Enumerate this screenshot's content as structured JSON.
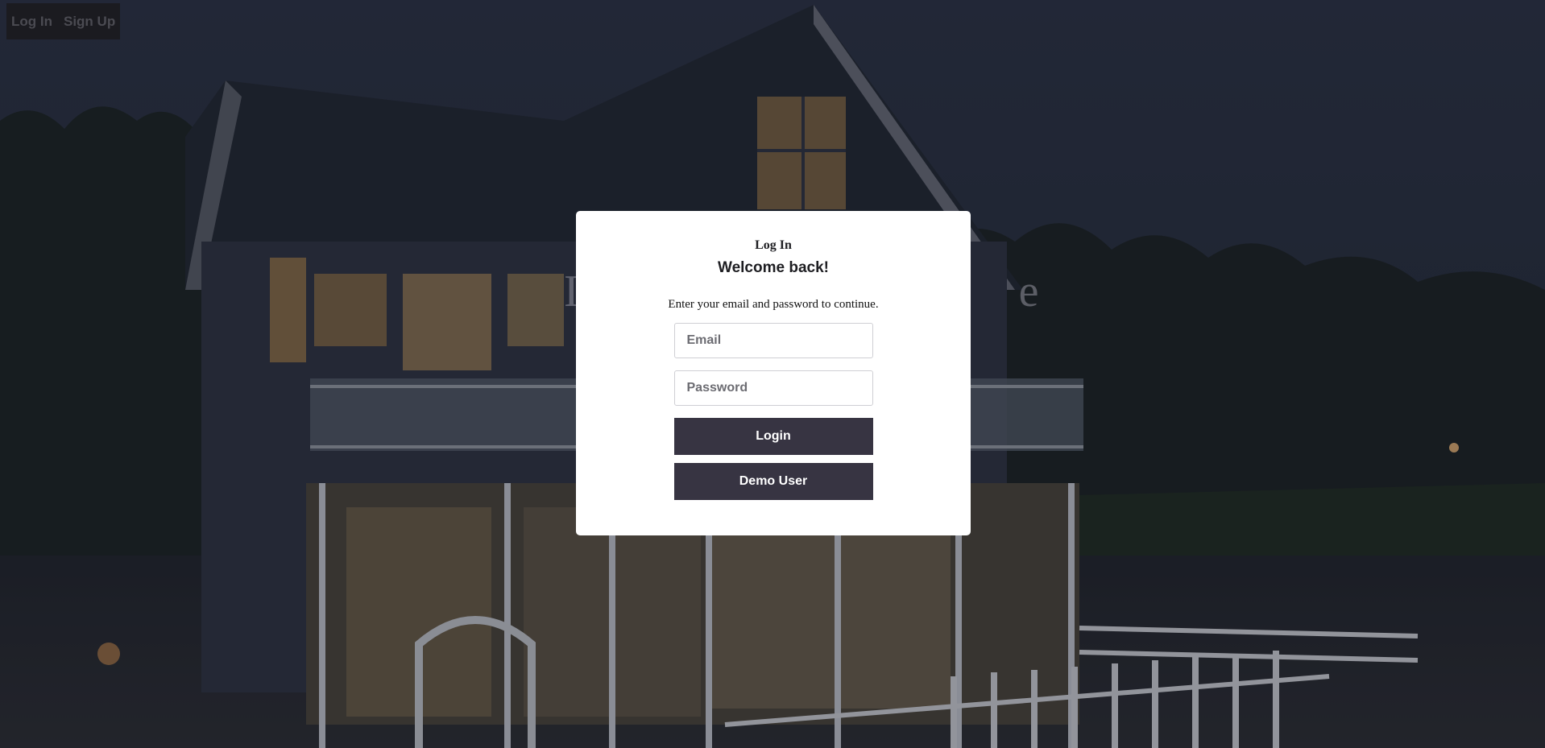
{
  "nav": {
    "login_label": "Log In",
    "signup_label": "Sign Up"
  },
  "modal": {
    "title": "Log In",
    "welcome": "Welcome back!",
    "instructions": "Enter your email and password to continue.",
    "email_placeholder": "Email",
    "password_placeholder": "Password",
    "login_button": "Login",
    "demo_button": "Demo User"
  },
  "colors": {
    "button_bg": "#373442",
    "modal_bg": "#ffffff",
    "nav_bg": "#1b1b20"
  }
}
